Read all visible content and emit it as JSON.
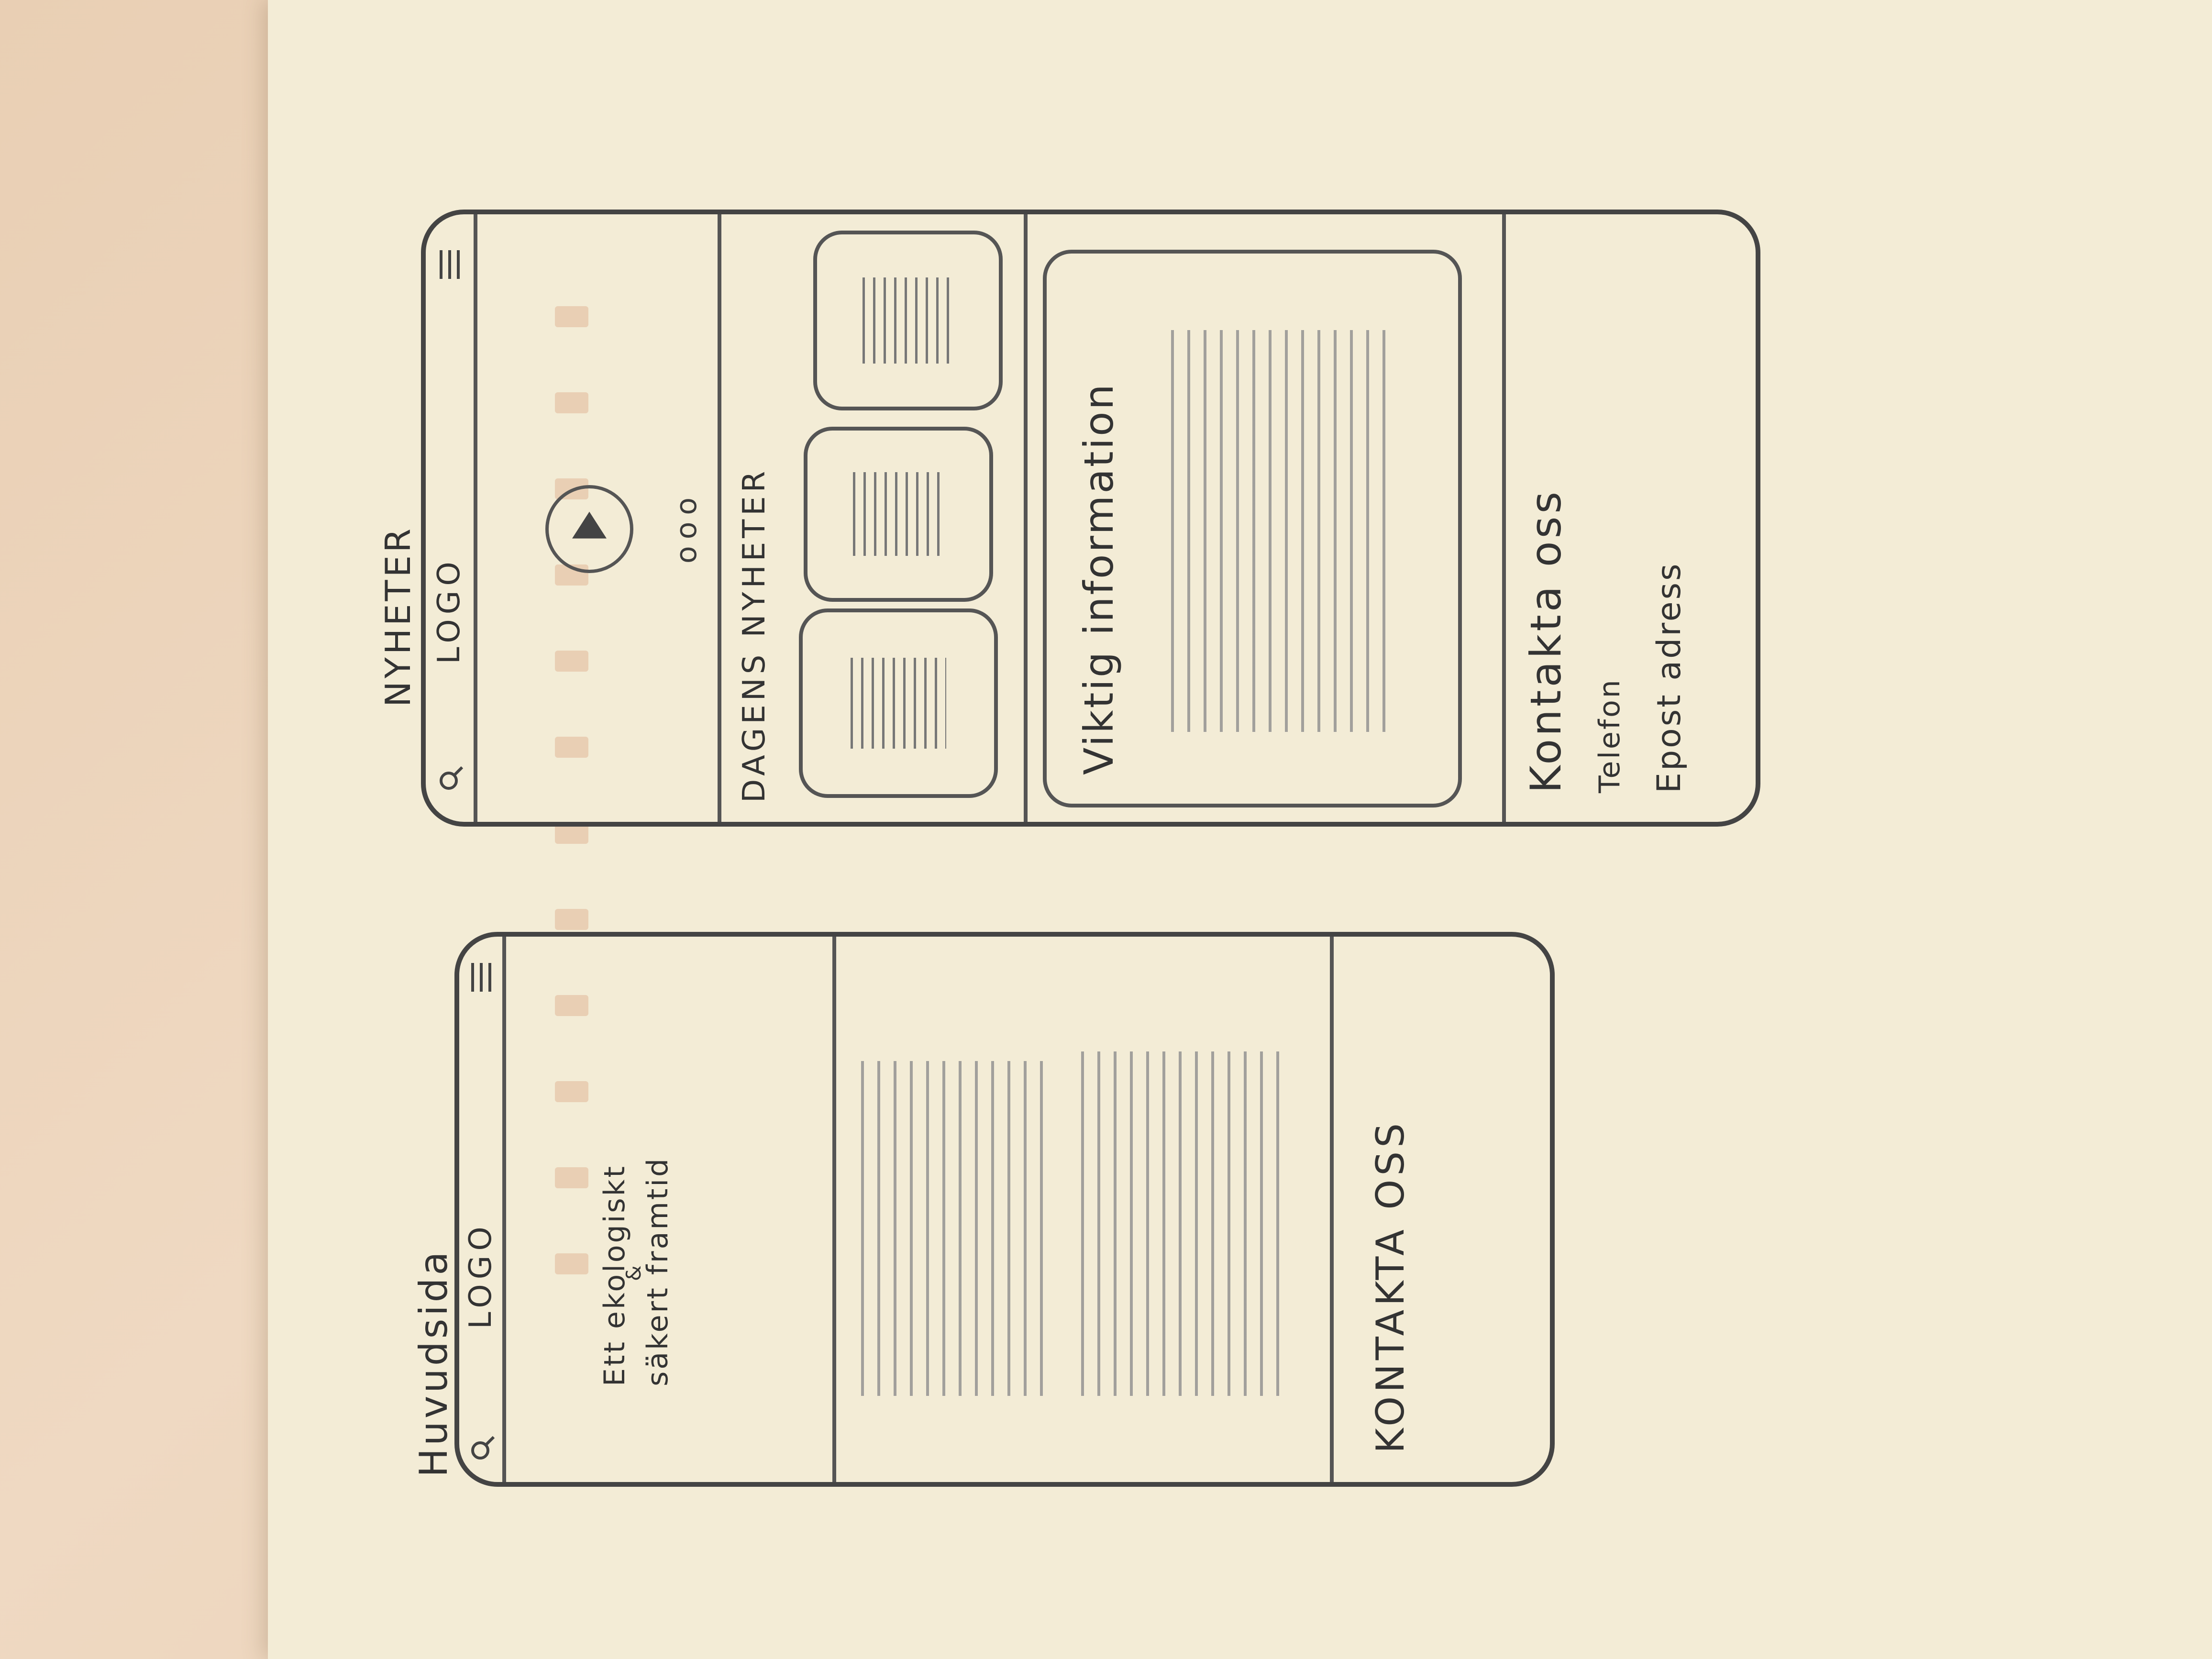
{
  "pages": [
    {
      "title": "Huvudsida",
      "header": {
        "logo": "LOGO"
      },
      "hero": {
        "text_line1": "Ett ekologiskt",
        "text_line2": "&",
        "text_line3": "säkert framtid"
      },
      "footer": {
        "contact": "KONTAKTA OSS"
      }
    },
    {
      "title": "NYHETER",
      "header": {
        "logo": "LOGO"
      },
      "carousel_dots": "ooo",
      "news": {
        "heading": "DAGENS NYHETER"
      },
      "info": {
        "heading": "Viktig information"
      },
      "contact": {
        "heading": "Kontakta oss",
        "phone": "Telefon",
        "email": "Epost adress"
      }
    }
  ],
  "icons": [
    "search-icon",
    "hamburger-menu-icon",
    "play-icon"
  ]
}
